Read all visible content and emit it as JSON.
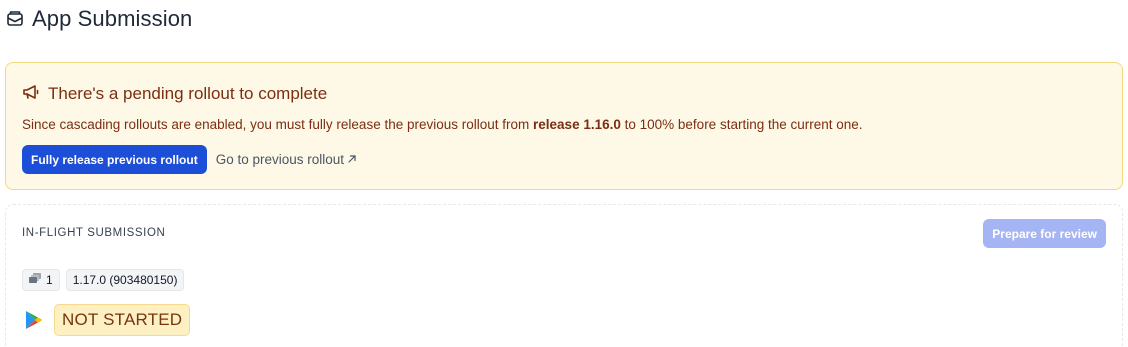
{
  "header": {
    "icon": "envelope-open-icon",
    "title": "App Submission"
  },
  "alert": {
    "icon": "megaphone-icon",
    "title": "There's a pending rollout to complete",
    "body_prefix": "Since cascading rollouts are enabled, you must fully release the previous rollout from ",
    "body_release": "release 1.16.0",
    "body_suffix": " to 100% before starting the current one.",
    "primary_button": "Fully release previous rollout",
    "link_label": "Go to previous rollout",
    "link_icon": "external-link-arrow-icon",
    "colors": {
      "background": "#fef9e6",
      "border": "#f5d77e",
      "text": "#7c2d12",
      "button": "#1d4ed8"
    }
  },
  "submission": {
    "section_label": "IN-FLIGHT SUBMISSION",
    "review_button": "Prepare for review",
    "review_button_disabled": true,
    "chips": [
      {
        "icon": "stack-icon",
        "label": "1"
      },
      {
        "label": "1.17.0 (903480150)"
      }
    ],
    "store_icon": "google-play-icon",
    "status": "NOT STARTED",
    "colors": {
      "status_background": "#fdf0c3",
      "status_text": "#78350f",
      "review_button": "#a5b4f2"
    }
  }
}
